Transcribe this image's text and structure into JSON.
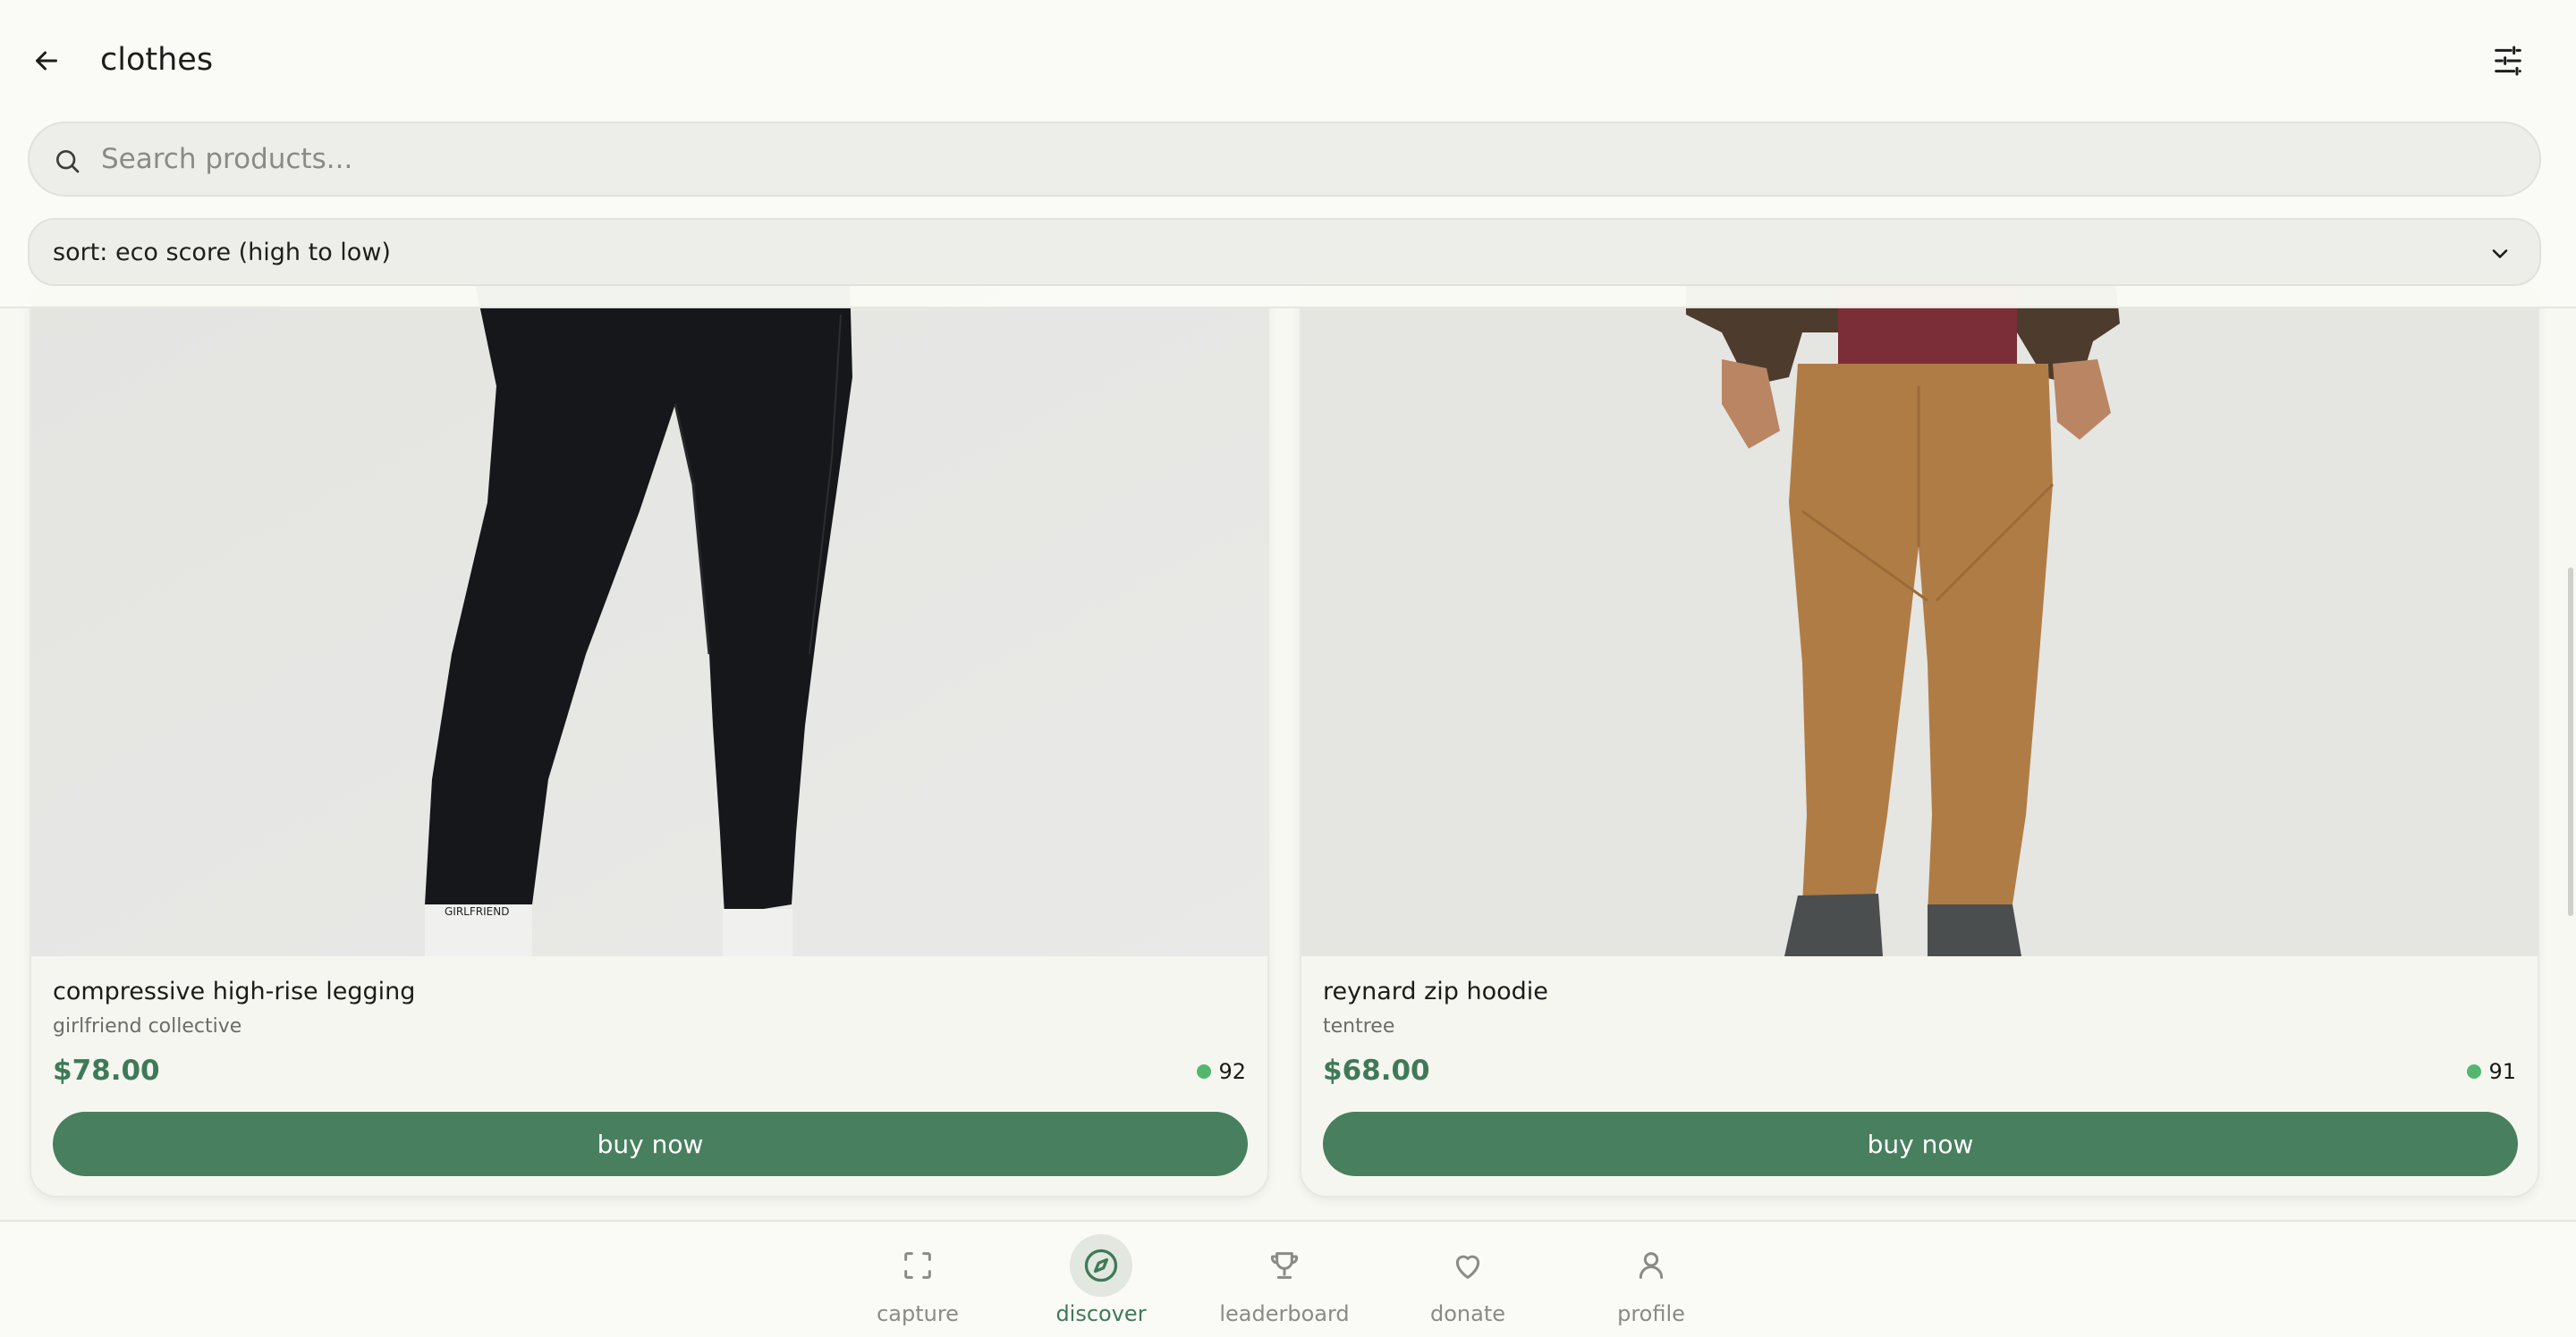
{
  "header": {
    "title": "clothes",
    "back_icon": "arrow-left-icon",
    "filter_icon": "sliders-icon"
  },
  "search": {
    "placeholder": "Search products...",
    "value": ""
  },
  "sort": {
    "label": "sort: eco score (high to low)"
  },
  "products": [
    {
      "name": "compressive high-rise legging",
      "brand": "girlfriend collective",
      "price": "$78.00",
      "eco_score": "92",
      "button_label": "buy now",
      "sock_text": "GIRLFRIEND"
    },
    {
      "name": "reynard zip hoodie",
      "brand": "tentree",
      "price": "$68.00",
      "eco_score": "91",
      "button_label": "buy now"
    }
  ],
  "nav": {
    "items": [
      {
        "label": "capture",
        "icon": "scan-icon"
      },
      {
        "label": "discover",
        "icon": "compass-icon",
        "active": true
      },
      {
        "label": "leaderboard",
        "icon": "trophy-icon"
      },
      {
        "label": "donate",
        "icon": "heart-icon"
      },
      {
        "label": "profile",
        "icon": "user-icon"
      }
    ]
  },
  "colors": {
    "accent": "#487f5e",
    "price": "#3e7a58",
    "eco_dot": "#52b76d",
    "background": "#f8f8f3"
  }
}
